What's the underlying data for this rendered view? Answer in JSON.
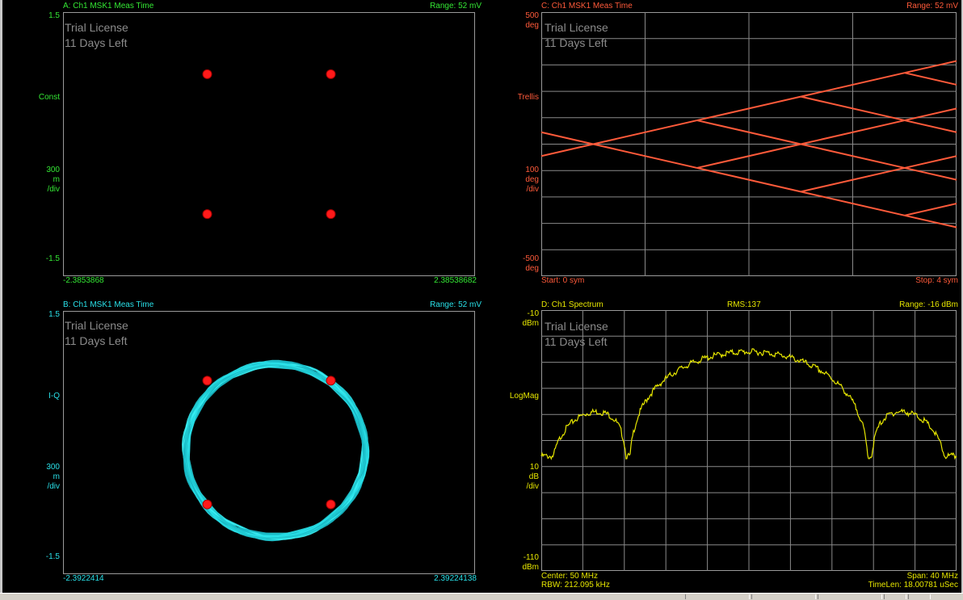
{
  "watermark": {
    "line1": "Trial License",
    "line2": "11 Days Left"
  },
  "traceA": {
    "header": "A: Ch1 MSK1 Meas Time",
    "range": "Range: 52 mV",
    "y_top": "1.5",
    "y_mid": "Const",
    "scale1": "300",
    "scale2": "m",
    "scale3": "/div",
    "y_bottom": "-1.5",
    "x_left": "-2.3853868",
    "x_right": "2.38538682",
    "color": "#34e834",
    "points": [
      [
        -1,
        1
      ],
      [
        1,
        1
      ],
      [
        -1,
        -1
      ],
      [
        1,
        -1
      ]
    ]
  },
  "traceB": {
    "header": "B: Ch1 MSK1 Meas Time",
    "range": "Range: 52 mV",
    "y_top": "1.5",
    "y_mid": "I-Q",
    "scale1": "300",
    "scale2": "m",
    "scale3": "/div",
    "y_bottom": "-1.5",
    "x_left": "-2.3922414",
    "x_right": "2.39224138",
    "color": "#29e0e8",
    "points": [
      [
        -1,
        1
      ],
      [
        1,
        1
      ],
      [
        -1,
        -1
      ],
      [
        1,
        -1
      ]
    ]
  },
  "traceC": {
    "header": "C: Ch1 MSK1 Meas Time",
    "range": "Range: 52 mV",
    "y_top1": "500",
    "y_top2": "deg",
    "y_mid": "Trellis",
    "scale1": "100",
    "scale2": "deg",
    "scale3": "/div",
    "y_bottom1": "-500",
    "y_bottom2": "deg",
    "footer_left": "Start: 0  sym",
    "footer_right": "Stop: 4  sym",
    "color": "#ff5a3a"
  },
  "traceD": {
    "header": "D: Ch1 Spectrum",
    "rms": "RMS:137",
    "range": "Range: -16 dBm",
    "y_top1": "-10",
    "y_top2": "dBm",
    "y_mid": "LogMag",
    "scale1": "10",
    "scale2": "dB",
    "scale3": "/div",
    "y_bottom1": "-110",
    "y_bottom2": "dBm",
    "footer_l1": "Center: 50 MHz",
    "footer_l2": "RBW: 212.095 kHz",
    "footer_r1": "Span: 40 MHz",
    "footer_r2": "TimeLen: 18.00781 uSec",
    "color": "#e6e600"
  }
}
